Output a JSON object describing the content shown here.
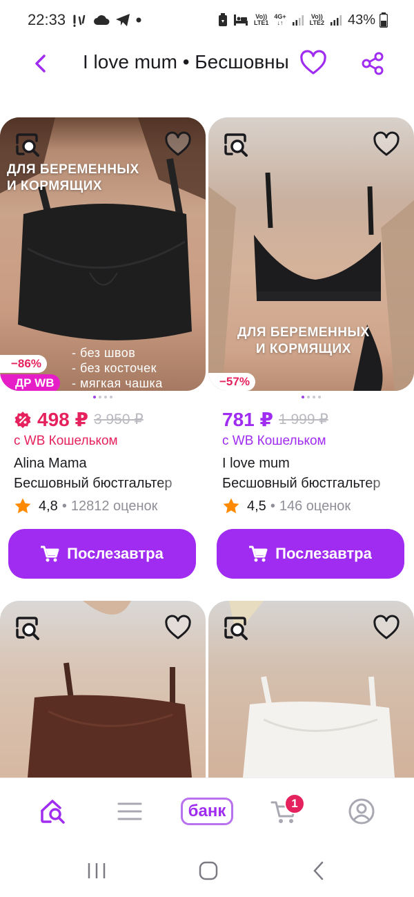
{
  "status_bar": {
    "time": "22:33",
    "signal1_label_top": "Vo))",
    "signal1_label_bottom": "LTE1",
    "network_type": "4G+",
    "signal2_label_top": "Vo))",
    "signal2_label_bottom": "LTE2",
    "battery": "43%"
  },
  "header": {
    "title": "I love mum • Бесшовный бюстгальтер"
  },
  "colors": {
    "accent": "#9f2cf0",
    "discount": "#e5225d",
    "wb_badge": "#e51ec8",
    "star": "#ff8a00"
  },
  "products": [
    {
      "overlay_top": "ДЛЯ БЕРЕМЕННЫХ\nИ КОРМЯЩИХ",
      "bullets": [
        "- без швов",
        "- без косточек",
        "- мягкая чашка"
      ],
      "discount": "−86%",
      "badge": "ДР WB",
      "price": "498 ₽",
      "old_price": "3 950 ₽",
      "wallet": "с WB Кошельком",
      "brand": "Alina Mama",
      "name": "Бесшовный бюстгальтер",
      "rating": "4,8",
      "reviews": "12812 оценок",
      "cta": "Послезавтра",
      "photo_dots": 4,
      "photo_active": 0
    },
    {
      "overlay_bottom": "ДЛЯ БЕРЕМЕННЫХ\nИ КОРМЯЩИХ",
      "discount": "−57%",
      "price": "781 ₽",
      "old_price": "1 999 ₽",
      "wallet": "с WB Кошельком",
      "brand": "I love mum",
      "name": "Бесшовный бюстгальтер",
      "rating": "4,5",
      "reviews": "146 оценок",
      "cta": "Послезавтра",
      "photo_dots": 4,
      "photo_active": 0
    },
    {},
    {}
  ],
  "bottom_nav": {
    "items": [
      "home-icon",
      "catalog-icon",
      "bank",
      "cart-icon",
      "profile-icon"
    ],
    "bank_label": "банк",
    "cart_count": "1"
  }
}
